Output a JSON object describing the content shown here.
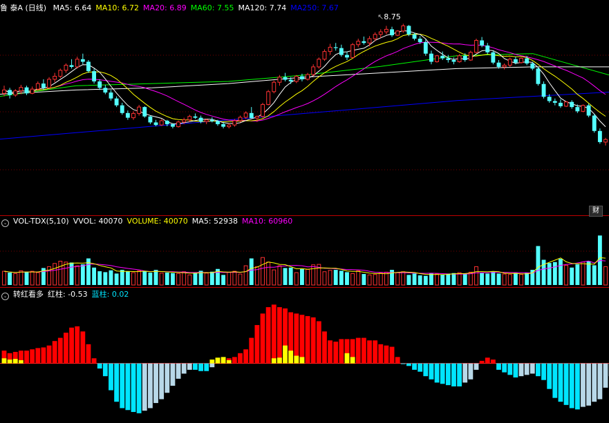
{
  "price_panel": {
    "title": "鲁 泰A (日线)",
    "ma_labels": [
      {
        "text": "MA5: 6.64",
        "color": "#ffffff"
      },
      {
        "text": "MA10: 6.72",
        "color": "#ffff00"
      },
      {
        "text": "MA20: 6.89",
        "color": "#ff00ff"
      },
      {
        "text": "MA60: 7.55",
        "color": "#00ff00"
      },
      {
        "text": "MA120: 7.74",
        "color": "#ffffff"
      },
      {
        "text": "MA250: 7.67",
        "color": "#0000ff"
      }
    ],
    "high_marker": "8.75",
    "badge": "财"
  },
  "volume_panel": {
    "labels": [
      {
        "text": "VOL-TDX(5,10)",
        "color": "#ffffff"
      },
      {
        "text": "VVOL: 40070",
        "color": "#ffffff"
      },
      {
        "text": "VOLUME: 40070",
        "color": "#ffff00"
      },
      {
        "text": "MA5: 52938",
        "color": "#ffffff"
      },
      {
        "text": "MA10: 60960",
        "color": "#ff00ff"
      }
    ]
  },
  "indicator_panel": {
    "labels": [
      {
        "text": "转红看多",
        "color": "#ffffff"
      },
      {
        "text": "红柱: -0.53",
        "color": "#ffffff"
      },
      {
        "text": "蓝柱: 0.02",
        "color": "#00e5ff"
      }
    ]
  },
  "chart_data": {
    "type": "candlestick",
    "title": "鲁 泰A (日线)",
    "ylim": [
      5.3,
      8.95
    ],
    "price_high": 8.75,
    "candles": [
      [
        7.12,
        7.3,
        7.05,
        7.2
      ],
      [
        7.2,
        7.25,
        7.0,
        7.08
      ],
      [
        7.08,
        7.22,
        7.04,
        7.18
      ],
      [
        7.18,
        7.32,
        7.1,
        7.26
      ],
      [
        7.26,
        7.3,
        7.08,
        7.12
      ],
      [
        7.12,
        7.28,
        7.1,
        7.22
      ],
      [
        7.22,
        7.4,
        7.18,
        7.35
      ],
      [
        7.35,
        7.45,
        7.2,
        7.25
      ],
      [
        7.25,
        7.5,
        7.22,
        7.45
      ],
      [
        7.45,
        7.6,
        7.38,
        7.52
      ],
      [
        7.52,
        7.7,
        7.48,
        7.66
      ],
      [
        7.66,
        7.82,
        7.6,
        7.78
      ],
      [
        7.78,
        7.92,
        7.7,
        7.74
      ],
      [
        7.74,
        7.98,
        7.7,
        7.92
      ],
      [
        7.92,
        8.05,
        7.8,
        7.86
      ],
      [
        7.86,
        7.9,
        7.6,
        7.64
      ],
      [
        7.64,
        7.7,
        7.35,
        7.4
      ],
      [
        7.4,
        7.45,
        7.2,
        7.25
      ],
      [
        7.25,
        7.32,
        7.1,
        7.14
      ],
      [
        7.14,
        7.2,
        6.95,
        7.0
      ],
      [
        7.0,
        7.05,
        6.8,
        6.84
      ],
      [
        6.84,
        6.9,
        6.62,
        6.66
      ],
      [
        6.66,
        6.72,
        6.5,
        6.55
      ],
      [
        6.55,
        6.7,
        6.5,
        6.65
      ],
      [
        6.65,
        6.85,
        6.6,
        6.8
      ],
      [
        6.8,
        6.82,
        6.55,
        6.58
      ],
      [
        6.58,
        6.6,
        6.4,
        6.44
      ],
      [
        6.44,
        6.5,
        6.35,
        6.38
      ],
      [
        6.38,
        6.52,
        6.36,
        6.48
      ],
      [
        6.48,
        6.5,
        6.35,
        6.4
      ],
      [
        6.4,
        6.42,
        6.3,
        6.34
      ],
      [
        6.34,
        6.48,
        6.32,
        6.45
      ],
      [
        6.45,
        6.55,
        6.4,
        6.5
      ],
      [
        6.5,
        6.62,
        6.45,
        6.58
      ],
      [
        6.58,
        6.65,
        6.52,
        6.55
      ],
      [
        6.55,
        6.6,
        6.42,
        6.46
      ],
      [
        6.46,
        6.52,
        6.4,
        6.5
      ],
      [
        6.5,
        6.56,
        6.44,
        6.47
      ],
      [
        6.47,
        6.5,
        6.36,
        6.4
      ],
      [
        6.4,
        6.45,
        6.3,
        6.34
      ],
      [
        6.34,
        6.42,
        6.3,
        6.38
      ],
      [
        6.38,
        6.52,
        6.34,
        6.48
      ],
      [
        6.48,
        6.6,
        6.44,
        6.56
      ],
      [
        6.56,
        6.7,
        6.52,
        6.66
      ],
      [
        6.66,
        6.8,
        6.6,
        6.54
      ],
      [
        6.54,
        6.6,
        6.45,
        6.58
      ],
      [
        6.58,
        6.9,
        6.55,
        6.86
      ],
      [
        6.86,
        7.2,
        6.84,
        7.16
      ],
      [
        7.16,
        7.42,
        7.12,
        7.38
      ],
      [
        7.38,
        7.55,
        7.3,
        7.5
      ],
      [
        7.5,
        7.6,
        7.4,
        7.44
      ],
      [
        7.44,
        7.5,
        7.34,
        7.4
      ],
      [
        7.4,
        7.55,
        7.36,
        7.52
      ],
      [
        7.52,
        7.58,
        7.4,
        7.45
      ],
      [
        7.45,
        7.6,
        7.42,
        7.56
      ],
      [
        7.56,
        7.8,
        7.52,
        7.74
      ],
      [
        7.74,
        7.96,
        7.7,
        7.92
      ],
      [
        7.92,
        8.15,
        7.88,
        8.1
      ],
      [
        8.1,
        8.28,
        8.02,
        8.2
      ],
      [
        8.2,
        8.3,
        8.12,
        8.18
      ],
      [
        8.18,
        8.26,
        7.98,
        8.02
      ],
      [
        8.02,
        8.1,
        7.9,
        7.96
      ],
      [
        7.96,
        8.3,
        7.94,
        8.26
      ],
      [
        8.26,
        8.4,
        8.2,
        8.34
      ],
      [
        8.34,
        8.45,
        8.26,
        8.3
      ],
      [
        8.3,
        8.46,
        8.22,
        8.4
      ],
      [
        8.4,
        8.55,
        8.34,
        8.5
      ],
      [
        8.5,
        8.62,
        8.42,
        8.56
      ],
      [
        8.56,
        8.7,
        8.5,
        8.62
      ],
      [
        8.62,
        8.68,
        8.44,
        8.48
      ],
      [
        8.48,
        8.6,
        8.46,
        8.58
      ],
      [
        8.58,
        8.75,
        8.54,
        8.7
      ],
      [
        8.7,
        8.72,
        8.46,
        8.5
      ],
      [
        8.5,
        8.54,
        8.36,
        8.4
      ],
      [
        8.4,
        8.46,
        8.28,
        8.32
      ],
      [
        8.32,
        8.38,
        8.0,
        8.05
      ],
      [
        8.05,
        8.12,
        7.8,
        7.86
      ],
      [
        7.86,
        8.02,
        7.84,
        8.0
      ],
      [
        8.0,
        8.1,
        7.9,
        7.94
      ],
      [
        7.94,
        8.02,
        7.84,
        7.9
      ],
      [
        7.9,
        7.96,
        7.8,
        7.86
      ],
      [
        7.86,
        8.04,
        7.84,
        8.0
      ],
      [
        8.0,
        8.06,
        7.86,
        7.9
      ],
      [
        7.9,
        8.12,
        7.88,
        8.08
      ],
      [
        8.08,
        8.4,
        8.06,
        8.36
      ],
      [
        8.36,
        8.44,
        8.2,
        8.24
      ],
      [
        8.24,
        8.3,
        8.04,
        8.08
      ],
      [
        8.08,
        8.12,
        7.8,
        7.84
      ],
      [
        7.84,
        7.9,
        7.7,
        7.74
      ],
      [
        7.74,
        7.82,
        7.68,
        7.78
      ],
      [
        7.78,
        7.96,
        7.74,
        7.92
      ],
      [
        7.92,
        7.98,
        7.8,
        7.84
      ],
      [
        7.84,
        7.96,
        7.82,
        7.94
      ],
      [
        7.94,
        8.0,
        7.78,
        7.82
      ],
      [
        7.82,
        7.86,
        7.66,
        7.7
      ],
      [
        7.7,
        7.74,
        7.3,
        7.34
      ],
      [
        7.34,
        7.4,
        7.0,
        7.04
      ],
      [
        7.04,
        7.1,
        6.9,
        6.94
      ],
      [
        6.94,
        7.0,
        6.84,
        6.9
      ],
      [
        6.9,
        6.98,
        6.78,
        6.82
      ],
      [
        6.82,
        6.94,
        6.8,
        6.92
      ],
      [
        6.92,
        6.96,
        6.76,
        6.8
      ],
      [
        6.8,
        6.86,
        6.66,
        6.7
      ],
      [
        6.7,
        6.86,
        6.68,
        6.84
      ],
      [
        6.84,
        6.88,
        6.56,
        6.6
      ],
      [
        6.6,
        6.64,
        6.2,
        6.24
      ],
      [
        6.24,
        6.3,
        5.94,
        5.98
      ],
      [
        5.98,
        6.08,
        5.9,
        6.04
      ]
    ],
    "ma_lines": [
      {
        "name": "MA60",
        "color": "#00ff00",
        "values": [
          7.05,
          7.3,
          7.35,
          7.4,
          7.55,
          7.75,
          8.0,
          8.05,
          7.55
        ]
      },
      {
        "name": "MA120",
        "color": "#ffffff",
        "values": [
          7.1,
          7.2,
          7.25,
          7.35,
          7.5,
          7.6,
          7.7,
          7.74,
          7.74
        ]
      },
      {
        "name": "MA250",
        "color": "#0000ff",
        "values": [
          6.05,
          6.2,
          6.35,
          6.5,
          6.65,
          6.8,
          6.95,
          7.05,
          7.15
        ]
      }
    ],
    "volume_ylim": [
      0,
      125000
    ],
    "volumes": [
      30000,
      27000,
      25000,
      31000,
      29000,
      30000,
      27000,
      37000,
      40000,
      47000,
      52000,
      50000,
      49000,
      42000,
      45000,
      58000,
      38000,
      30000,
      28000,
      32000,
      25000,
      33000,
      30000,
      27000,
      31000,
      30000,
      27000,
      33000,
      26000,
      27000,
      26000,
      25000,
      29000,
      22000,
      27000,
      31000,
      26000,
      29000,
      35000,
      22000,
      28000,
      30000,
      24000,
      42000,
      58000,
      40000,
      60000,
      50000,
      33000,
      42000,
      37000,
      38000,
      27000,
      35000,
      34000,
      44000,
      45000,
      29000,
      32000,
      33000,
      31000,
      28000,
      25000,
      31000,
      24000,
      22000,
      23000,
      26000,
      28000,
      33000,
      27000,
      29000,
      22000,
      25000,
      21000,
      20000,
      26000,
      24000,
      22000,
      25000,
      26000,
      27000,
      25000,
      28000,
      40000,
      26000,
      25000,
      29000,
      25000,
      24000,
      23000,
      26000,
      23000,
      27000,
      33000,
      85000,
      55000,
      48000,
      50000,
      57000,
      43000,
      38000,
      45000,
      50000,
      52000,
      43000,
      108000,
      40070
    ],
    "oscillator_ylim": [
      -9.0,
      10.0
    ],
    "oscillator": [
      2.0,
      1.6,
      1.8,
      2.0,
      2.0,
      2.2,
      2.4,
      2.5,
      2.8,
      3.5,
      4.0,
      4.8,
      5.6,
      5.8,
      5.0,
      3.0,
      0.8,
      -0.8,
      -2.0,
      -4.2,
      -6.0,
      -7.0,
      -7.3,
      -7.6,
      -7.8,
      -7.4,
      -7.0,
      -6.2,
      -5.6,
      -4.6,
      -3.5,
      -2.4,
      -1.6,
      -1.0,
      -1.0,
      -1.2,
      -1.2,
      -0.6,
      0.3,
      0.6,
      0.8,
      1.0,
      1.6,
      2.2,
      4.0,
      6.0,
      7.8,
      8.8,
      9.2,
      8.8,
      8.6,
      8.0,
      7.8,
      7.6,
      7.4,
      7.2,
      6.6,
      5.0,
      3.6,
      3.4,
      3.8,
      3.8,
      3.8,
      4.0,
      4.0,
      3.6,
      3.6,
      3.0,
      2.8,
      2.6,
      1.0,
      -0.1,
      -0.4,
      -1.0,
      -1.3,
      -2.0,
      -2.5,
      -3.0,
      -3.2,
      -3.4,
      -3.6,
      -3.6,
      -3.0,
      -2.5,
      -1.0,
      0.4,
      0.9,
      0.6,
      -1.0,
      -1.4,
      -1.8,
      -2.2,
      -2.0,
      -1.8,
      -1.6,
      -2.0,
      -2.6,
      -4.0,
      -5.4,
      -6.0,
      -6.5,
      -7.0,
      -7.2,
      -6.8,
      -6.6,
      -6.0,
      -5.6,
      -3.8,
      -2.0
    ],
    "oscillator_yellow": [
      0.8,
      0.6,
      0.7,
      0.5,
      0.0,
      0,
      0,
      0,
      0,
      0,
      0,
      0,
      0,
      0,
      0,
      0,
      0,
      0,
      0,
      0,
      0,
      0,
      0,
      0,
      0,
      0,
      0,
      0,
      0,
      0,
      0,
      0,
      0,
      0,
      0,
      0,
      0,
      0.6,
      0.9,
      1.0,
      0.5,
      0,
      0,
      0,
      0,
      0,
      0,
      0,
      0.8,
      0.9,
      2.8,
      2.0,
      1.2,
      1.0,
      0,
      0,
      0,
      0,
      0,
      0,
      0,
      1.6,
      1.0,
      0,
      0,
      0,
      0,
      0,
      0,
      0,
      0,
      0,
      0,
      0,
      0,
      0,
      0,
      0,
      0,
      0,
      0,
      0,
      0,
      0,
      0,
      0,
      0,
      0,
      0,
      0,
      0,
      0,
      0,
      0,
      0,
      0,
      0,
      0,
      0,
      0,
      0,
      0,
      0,
      0,
      0,
      0,
      0,
      0,
      0,
      0
    ]
  }
}
